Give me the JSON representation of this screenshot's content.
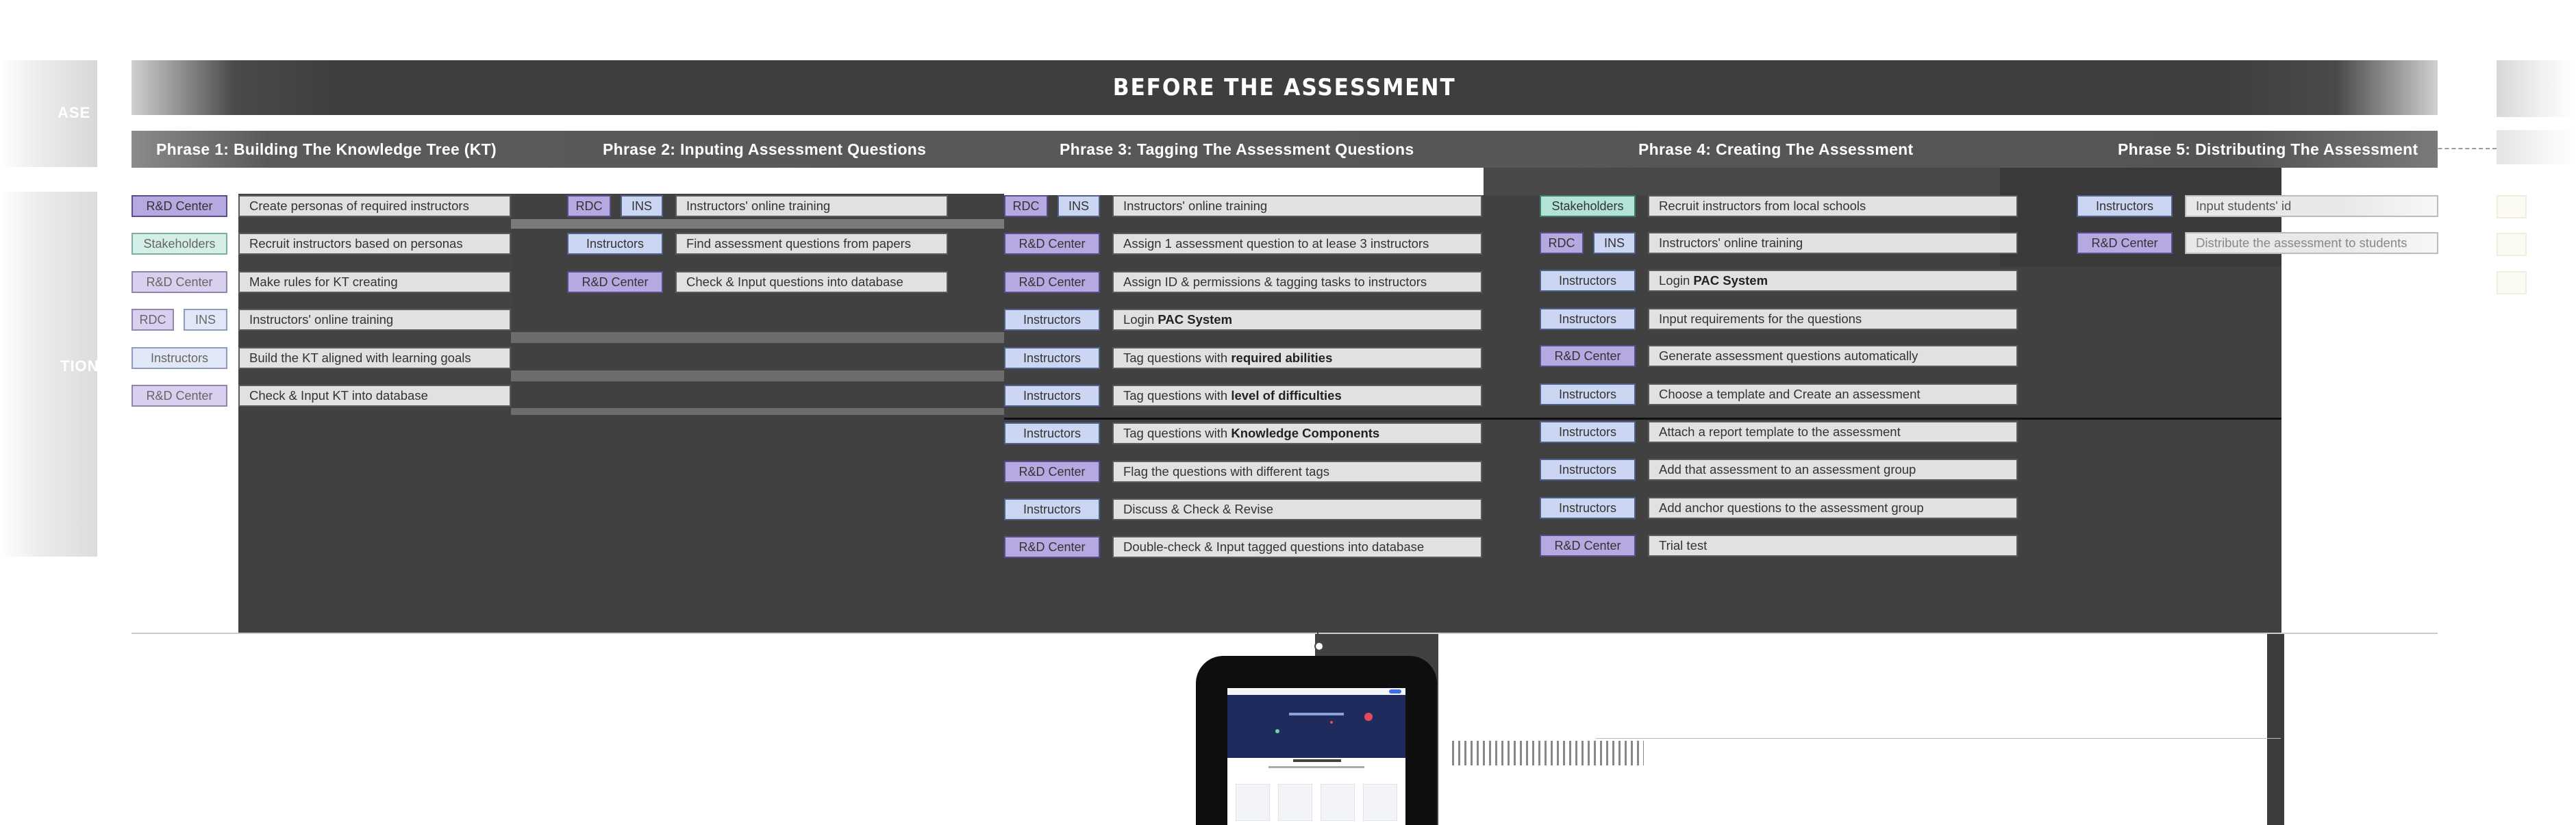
{
  "banner": {
    "title": "BEFORE THE ASSESSMENT"
  },
  "ghost_labels": {
    "left_top": "ASE",
    "left_mid": "TION"
  },
  "phases": [
    {
      "title": "Phrase 1: Building The Knowledge Tree (KT)"
    },
    {
      "title": "Phrase 2: Inputing Assessment Questions"
    },
    {
      "title": "Phrase 3: Tagging The Assessment Questions"
    },
    {
      "title": "Phrase 4: Creating The Assessment"
    },
    {
      "title": "Phrase 5: Distributing The Assessment"
    }
  ],
  "phase1": {
    "roles": [
      "R&D Center",
      "Stakeholders",
      "R&D Center",
      "RDC",
      "INS",
      "Instructors",
      "R&D Center"
    ],
    "tasks": [
      "Create personas of required instructors",
      "Recruit instructors based on personas",
      "Make rules for KT creating",
      "Instructors' online training",
      "Build the KT aligned with learning goals",
      "Check & Input KT into database"
    ]
  },
  "phase2": {
    "roles": [
      "RDC",
      "INS",
      "Instructors",
      "R&D Center"
    ],
    "tasks": [
      "Instructors' online training",
      "Find assessment questions from papers",
      "Check & Input questions into database"
    ]
  },
  "phase3": {
    "roles": [
      "RDC",
      "INS",
      "R&D Center",
      "R&D Center",
      "Instructors",
      "Instructors",
      "Instructors",
      "Instructors",
      "R&D Center",
      "Instructors",
      "R&D Center"
    ],
    "tasks": [
      {
        "pre": "Instructors' online training",
        "bold": "",
        "post": ""
      },
      {
        "pre": "Assign 1 assessment question to at lease 3 instructors",
        "bold": "",
        "post": ""
      },
      {
        "pre": "Assign ID & permissions & tagging tasks to instructors",
        "bold": "",
        "post": ""
      },
      {
        "pre": "Login ",
        "bold": "PAC System",
        "post": ""
      },
      {
        "pre": "Tag questions with ",
        "bold": "required abilities",
        "post": ""
      },
      {
        "pre": "Tag questions with ",
        "bold": "level of difficulties",
        "post": ""
      },
      {
        "pre": "Tag questions with ",
        "bold": "Knowledge Components",
        "post": ""
      },
      {
        "pre": "Flag the questions with different tags",
        "bold": "",
        "post": ""
      },
      {
        "pre": "Discuss & Check & Revise",
        "bold": "",
        "post": ""
      },
      {
        "pre": "Double-check & Input tagged questions into database",
        "bold": "",
        "post": ""
      }
    ]
  },
  "phase4": {
    "roles": [
      "Stakeholders",
      "RDC",
      "INS",
      "Instructors",
      "Instructors",
      "R&D Center",
      "Instructors",
      "Instructors",
      "Instructors",
      "Instructors",
      "R&D Center"
    ],
    "tasks": [
      {
        "pre": "Recruit instructors from local schools",
        "bold": ""
      },
      {
        "pre": "Instructors' online training",
        "bold": ""
      },
      {
        "pre": "Login ",
        "bold": "PAC System"
      },
      {
        "pre": "Input requirements for the questions",
        "bold": ""
      },
      {
        "pre": "Generate assessment questions automatically",
        "bold": ""
      },
      {
        "pre": "Choose a template and Create an assessment",
        "bold": ""
      },
      {
        "pre": "Attach a report template to the assessment",
        "bold": ""
      },
      {
        "pre": "Add that assessment to an assessment group",
        "bold": ""
      },
      {
        "pre": "Add anchor questions to the assessment group",
        "bold": ""
      },
      {
        "pre": "Trial test",
        "bold": ""
      }
    ]
  },
  "phase5": {
    "roles": [
      "Instructors",
      "R&D Center"
    ],
    "tasks": [
      "Input students' id",
      "Distribute the assessment to students"
    ]
  },
  "colors": {
    "banner": "#3e3e3e",
    "phase_bar": "#555555",
    "panel": "#414141",
    "role_purple": "#b6a8e0",
    "role_blue": "#cbd6f3",
    "role_green": "#b3e3d6",
    "task_bg": "#e1e1e1"
  }
}
